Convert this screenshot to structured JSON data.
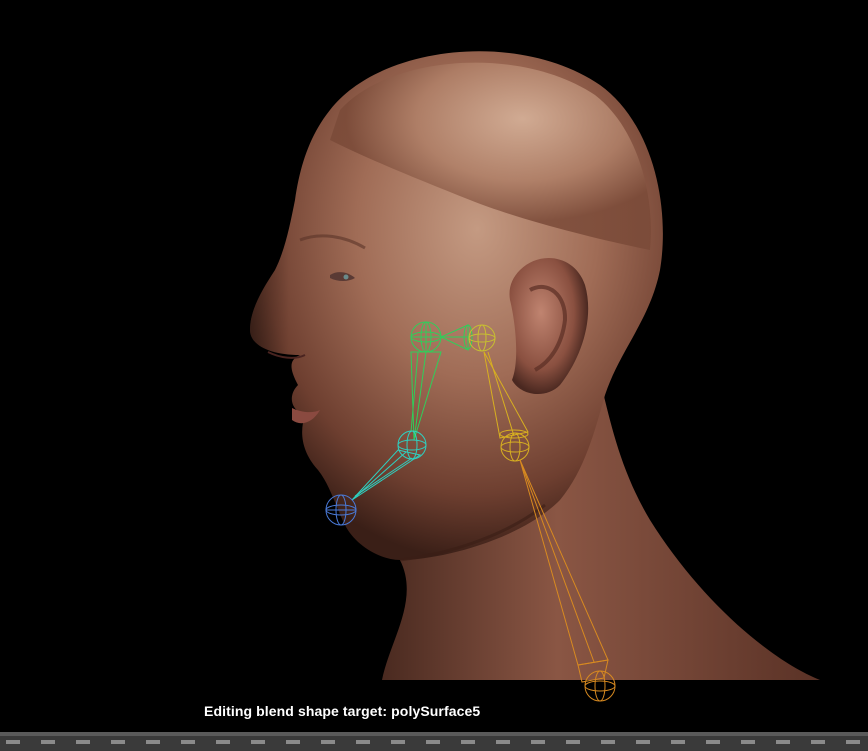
{
  "viewport": {
    "background": "#000000",
    "status_label": "Editing blend shape target:",
    "status_target": "polySurface5"
  },
  "rig": {
    "colors": {
      "green_chain": "#2fcf5a",
      "teal_chain": "#2fd0c0",
      "blue_joint": "#4a7ad8",
      "yellow_chain": "#d8b020",
      "orange_chain": "#d88a20"
    },
    "joints": [
      "jaw-root-joint",
      "jaw-mid-joint",
      "chin-joint",
      "neck-top-joint",
      "neck-mid-joint",
      "neck-base-joint"
    ]
  },
  "timeline": {
    "background": "#3a3a3a",
    "visible": true
  }
}
